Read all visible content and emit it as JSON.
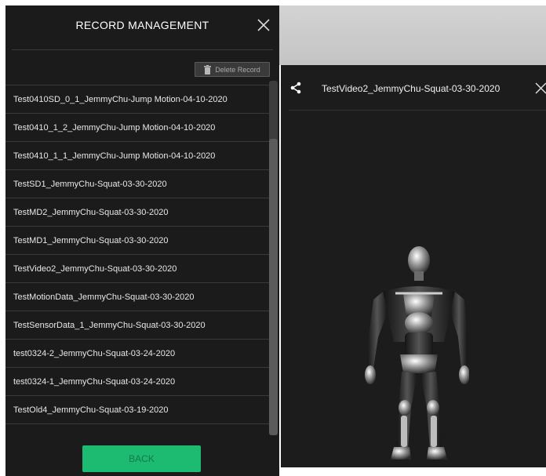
{
  "left_panel": {
    "title": "RECORD MANAGEMENT",
    "close_icon": "close-icon",
    "delete_label": "Delete Record",
    "back_label": "BACK",
    "records": [
      "Test0410SD_0_1_JemmyChu-Jump Motion-04-10-2020",
      "Test0410_1_2_JemmyChu-Jump Motion-04-10-2020",
      "Test0410_1_1_JemmyChu-Jump Motion-04-10-2020",
      "TestSD1_JemmyChu-Squat-03-30-2020",
      "TestMD2_JemmyChu-Squat-03-30-2020",
      "TestMD1_JemmyChu-Squat-03-30-2020",
      "TestVideo2_JemmyChu-Squat-03-30-2020",
      "TestMotionData_JemmyChu-Squat-03-30-2020",
      "TestSensorData_1_JemmyChu-Squat-03-30-2020",
      "test0324-2_JemmyChu-Squat-03-24-2020",
      "test0324-1_JemmyChu-Squat-03-24-2020",
      "TestOld4_JemmyChu-Squat-03-19-2020"
    ]
  },
  "viewer": {
    "title": "TestVideo2_JemmyChu-Squat-03-30-2020",
    "share_icon": "share-icon",
    "close_icon": "close-icon"
  },
  "colors": {
    "panel_bg": "#1b1b1b",
    "accent_green": "#1dba72",
    "divider": "#3a3a3a"
  }
}
